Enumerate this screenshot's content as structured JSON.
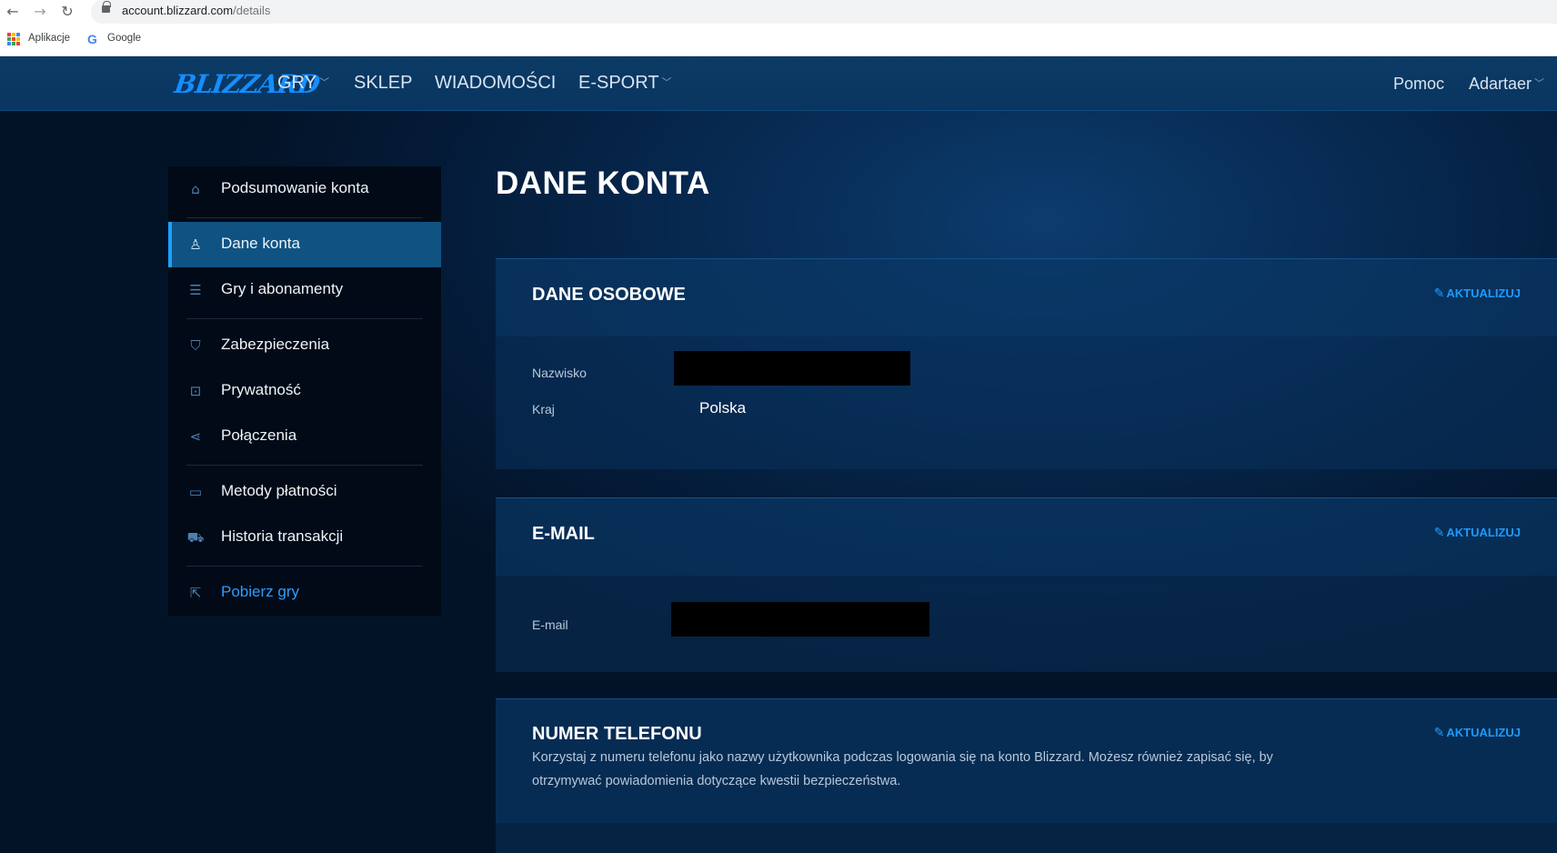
{
  "browser": {
    "url_host": "account.blizzard.com",
    "url_path": "/details",
    "bookmarks": [
      {
        "label": "Aplikacje",
        "icon": "apps-grid-icon"
      },
      {
        "label": "Google",
        "icon": "google-icon"
      }
    ]
  },
  "topnav": {
    "logo": "BLIZZARD",
    "items": [
      {
        "label": "GRY",
        "dropdown": true
      },
      {
        "label": "SKLEP",
        "dropdown": false
      },
      {
        "label": "WIADOMOŚCI",
        "dropdown": false
      },
      {
        "label": "E-SPORT",
        "dropdown": true
      }
    ],
    "help": "Pomoc",
    "user": "Adartaer"
  },
  "sidebar": {
    "items": [
      {
        "label": "Podsumowanie konta",
        "icon": "home-icon"
      },
      {
        "label": "Dane konta",
        "icon": "user-icon",
        "active": true
      },
      {
        "label": "Gry i abonamenty",
        "icon": "list-icon"
      },
      {
        "label": "Zabezpieczenia",
        "icon": "shield-icon"
      },
      {
        "label": "Prywatność",
        "icon": "lock-icon"
      },
      {
        "label": "Połączenia",
        "icon": "share-icon"
      },
      {
        "label": "Metody płatności",
        "icon": "credit-card-icon"
      },
      {
        "label": "Historia transakcji",
        "icon": "cart-icon"
      },
      {
        "label": "Pobierz gry",
        "icon": "external-link-icon"
      }
    ]
  },
  "main": {
    "title": "DANE KONTA",
    "update_label": "AKTUALIZUJ",
    "personal": {
      "title": "DANE OSOBOWE",
      "fields": [
        {
          "label": "Nazwisko",
          "value": ""
        },
        {
          "label": "Kraj",
          "value": "Polska"
        }
      ]
    },
    "email": {
      "title": "E-MAIL",
      "fields": [
        {
          "label": "E-mail",
          "value": ""
        }
      ]
    },
    "phone": {
      "title": "NUMER TELEFONU",
      "description": "Korzystaj z numeru telefonu jako nazwy użytkownika podczas logowania się na konto Blizzard. Możesz również zapisać się, by otrzymywać powiadomienia dotyczące kwestii bezpieczeństwa."
    }
  },
  "colors": {
    "accent": "#1e9bff",
    "sidebar_active": "#0f5383",
    "sidebar_bg": "#010a16"
  }
}
